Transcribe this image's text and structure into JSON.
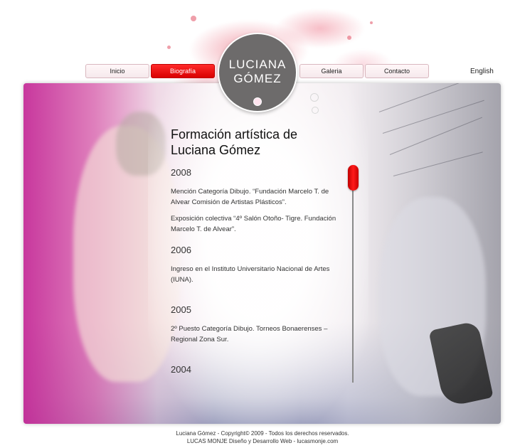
{
  "nav": {
    "items": [
      {
        "label": "Inicio",
        "active": false
      },
      {
        "label": "Biografía",
        "active": true
      },
      {
        "label": "Galeria",
        "active": false
      },
      {
        "label": "Contacto",
        "active": false
      }
    ],
    "language": "English"
  },
  "logo": {
    "line1": "LUCIANA",
    "line2": "GÓMEZ"
  },
  "content": {
    "title_line1": "Formación artística de",
    "title_line2": "Luciana Gómez",
    "sections": [
      {
        "year": "2008",
        "entries": [
          "Mención Categoría Dibujo. “Fundación Marcelo T. de Alvear Comisión de Artistas Plásticos”.",
          "Exposición colectiva “4º Salón Otoño- Tigre. Fundación Marcelo T. de Alvear”."
        ]
      },
      {
        "year": "2006",
        "entries": [
          "Ingreso en el Instituto Universitario Nacional de Artes (IUNA)."
        ]
      },
      {
        "year": "2005",
        "entries": [
          "2º Puesto Categoría Dibujo. Torneos Bonaerenses – Regional Zona Sur."
        ]
      },
      {
        "year": "2004",
        "entries": []
      }
    ]
  },
  "scrollbar": {
    "position": 0
  },
  "footer": {
    "line1": "Luciana Gómez - Copyright© 2009 - Todos los derechos reservados.",
    "line2": "LUCAS MONJE Diseño y Desarrollo Web - lucasmonje.com"
  },
  "colors": {
    "accent": "#e00000",
    "logo_bg": "#6d6b6b",
    "splash": "#e85a6e"
  }
}
